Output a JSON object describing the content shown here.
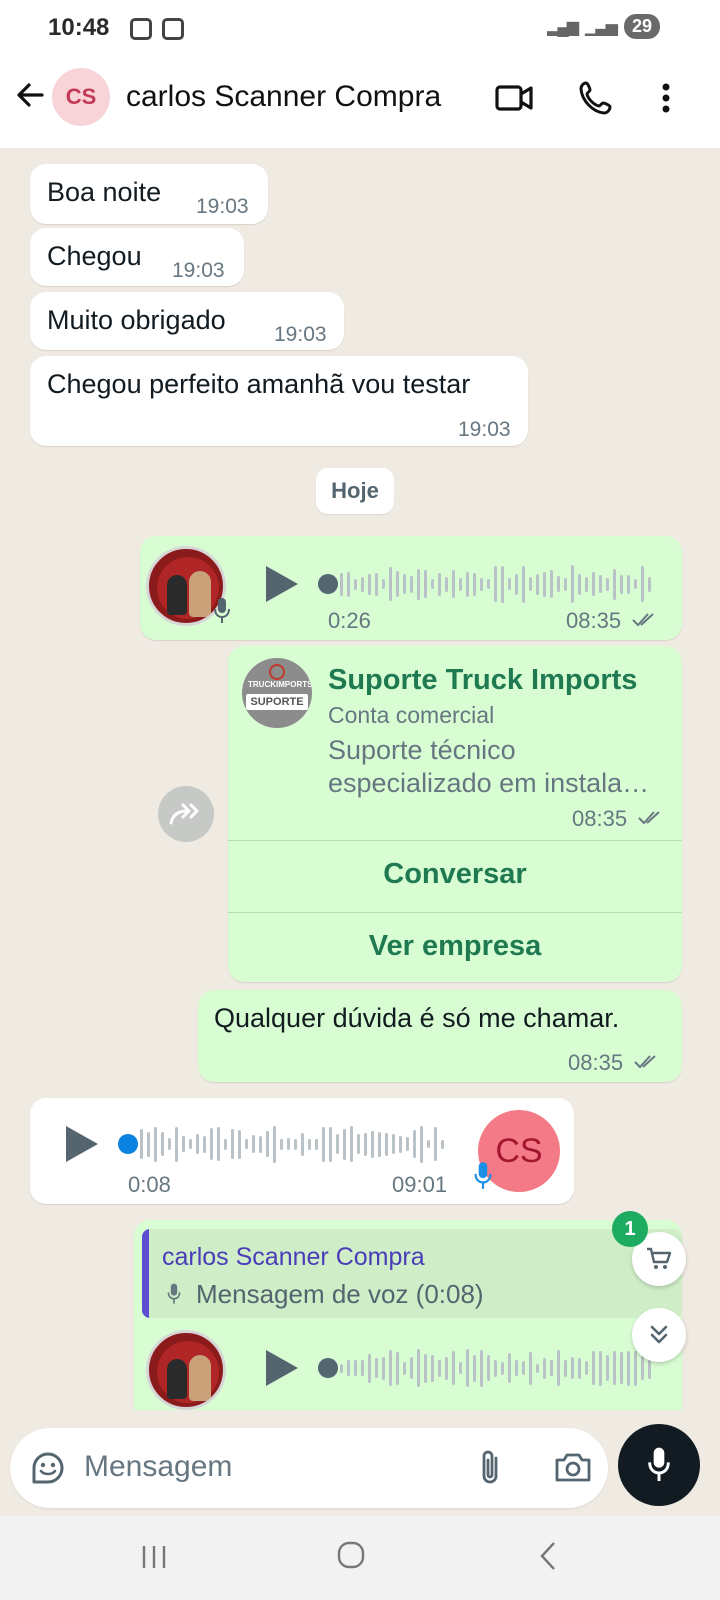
{
  "status_bar": {
    "time": "10:48",
    "battery": "29"
  },
  "header": {
    "avatar_initials": "CS",
    "contact_name": "carlos Scanner Compra"
  },
  "messages_in": [
    {
      "text": "Boa noite",
      "time": "19:03"
    },
    {
      "text": "Chegou",
      "time": "19:03"
    },
    {
      "text": "Muito obrigado",
      "time": "19:03"
    },
    {
      "text": "Chegou perfeito amanhã vou testar",
      "time": "19:03"
    }
  ],
  "day_divider": "Hoje",
  "voice_out_1": {
    "duration": "0:26",
    "time": "08:35"
  },
  "business_card": {
    "logo_top": "TRUCKIMPORTS",
    "logo_label": "SUPORTE",
    "name": "Suporte Truck Imports",
    "subtitle": "Conta comercial",
    "desc_line1": "Suporte técnico",
    "desc_line2": "especializado em instala…",
    "time": "08:35",
    "action_chat": "Conversar",
    "action_view": "Ver empresa"
  },
  "message_out_text": {
    "text": "Qualquer dúvida é só me chamar.",
    "time": "08:35"
  },
  "voice_in": {
    "duration": "0:08",
    "time": "09:01",
    "avatar_initials": "CS"
  },
  "reply_quote": {
    "author": "carlos Scanner Compra",
    "text": "Mensagem de voz (0:08)"
  },
  "cart_badge": "1",
  "composer": {
    "placeholder": "Mensagem"
  },
  "colors": {
    "accent": "#1daa61",
    "outgoing_bubble": "#d9fdd3",
    "chat_bg": "#efeae2",
    "voice_dot_in": "#0a84e0"
  }
}
